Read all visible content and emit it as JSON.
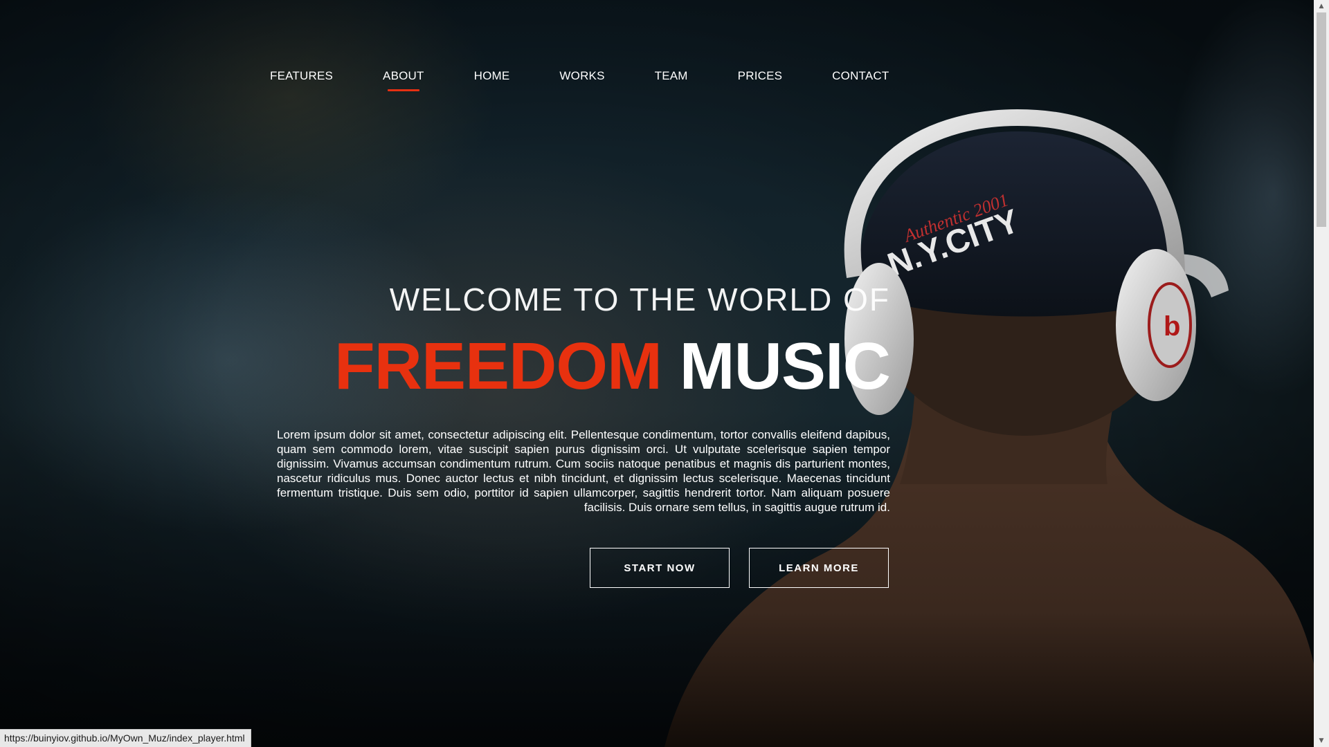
{
  "nav": {
    "items": [
      {
        "label": "FEATURES",
        "active": false
      },
      {
        "label": "ABOUT",
        "active": true
      },
      {
        "label": "HOME",
        "active": false
      },
      {
        "label": "WORKS",
        "active": false
      },
      {
        "label": "TEAM",
        "active": false
      },
      {
        "label": "PRICES",
        "active": false
      },
      {
        "label": "CONTACT",
        "active": false
      }
    ]
  },
  "hero": {
    "welcome": "WELCOME TO THE WORLD OF",
    "headline_red": "FREEDOM",
    "headline_white": "MUSIC",
    "description": "Lorem ipsum dolor sit amet, consectetur adipiscing elit. Pellentesque condimentum, tortor convallis eleifend dapibus, quam sem commodo lorem, vitae suscipit sapien purus dignissim orci. Ut vulputate scelerisque sapien tempor dignissim. Vivamus accumsan condimentum rutrum. Cum sociis natoque penatibus et magnis dis parturient montes, nascetur ridiculus mus. Donec auctor lectus et nibh tincidunt, et dignissim lectus scelerisque. Maecenas tincidunt fermentum tristique. Duis sem odio, porttitor id sapien ullamcorper, sagittis hendrerit tortor. Nam aliquam posuere facilisis. Duis ornare sem tellus, in sagittis augue rutrum id.",
    "cap_text": "N.Y.CITY",
    "cap_script": "Authentic 2001",
    "headphone_logo": "b"
  },
  "buttons": {
    "start": "START NOW",
    "learn": "LEARN MORE"
  },
  "status_bar": {
    "url": "https://buinyiov.github.io/MyOwn_Muz/index_player.html"
  },
  "colors": {
    "accent": "#e8310f",
    "text": "#ffffff"
  },
  "icons": {
    "scroll_up": "scroll-up-arrow-icon",
    "scroll_down": "scroll-down-arrow-icon"
  }
}
